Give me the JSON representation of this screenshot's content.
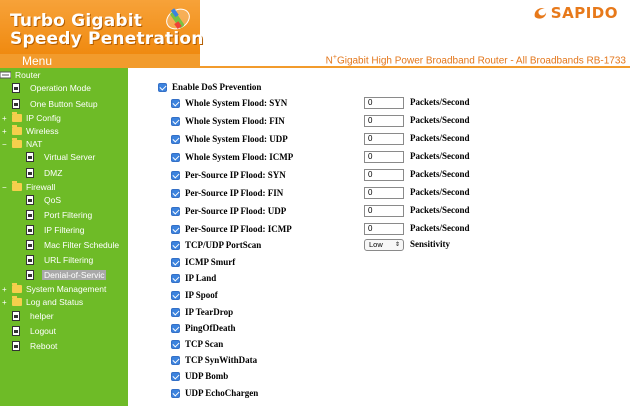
{
  "brand": {
    "line1": "Turbo Gigabit",
    "line2": "Speedy Penetration",
    "logo_text": "SAPIDO",
    "menu_label": "Menu",
    "tagline_prefix": "N",
    "tagline_sup": "+",
    "tagline": "Gigabit High Power Broadband Router - All Broadbands   RB-1733",
    "accent": "#f29b2c",
    "sidebar_color": "#6ebb27"
  },
  "sidebar": {
    "root": "Router",
    "items": [
      {
        "label": "Operation Mode"
      },
      {
        "label": "One Button Setup"
      },
      {
        "label": "IP Config"
      },
      {
        "label": "Wireless"
      },
      {
        "label": "NAT"
      },
      {
        "label": "Virtual Server"
      },
      {
        "label": "DMZ"
      },
      {
        "label": "Firewall"
      },
      {
        "label": "QoS"
      },
      {
        "label": "Port Filtering"
      },
      {
        "label": "IP Filtering"
      },
      {
        "label": "Mac Filter Schedule"
      },
      {
        "label": "URL Filtering"
      },
      {
        "label": "Denial-of-Servic"
      },
      {
        "label": "System Management"
      },
      {
        "label": "Log and Status"
      },
      {
        "label": "helper"
      },
      {
        "label": "Logout"
      },
      {
        "label": "Reboot"
      }
    ]
  },
  "dos": {
    "enable_label": "Enable DoS Prevention",
    "unit": "Packets/Second",
    "sensitivity_label": "Sensitivity",
    "sensitivity_value": "Low",
    "floods": [
      {
        "label": "Whole System Flood: SYN",
        "value": "0"
      },
      {
        "label": "Whole System Flood: FIN",
        "value": "0"
      },
      {
        "label": "Whole System Flood: UDP",
        "value": "0"
      },
      {
        "label": "Whole System Flood: ICMP",
        "value": "0"
      },
      {
        "label": "Per-Source IP Flood: SYN",
        "value": "0"
      },
      {
        "label": "Per-Source IP Flood: FIN",
        "value": "0"
      },
      {
        "label": "Per-Source IP Flood: UDP",
        "value": "0"
      },
      {
        "label": "Per-Source IP Flood: ICMP",
        "value": "0"
      }
    ],
    "portscan_label": "TCP/UDP PortScan",
    "options": [
      {
        "label": "ICMP Smurf"
      },
      {
        "label": "IP Land"
      },
      {
        "label": "IP Spoof"
      },
      {
        "label": "IP TearDrop"
      },
      {
        "label": "PingOfDeath"
      },
      {
        "label": "TCP Scan"
      },
      {
        "label": "TCP SynWithData"
      },
      {
        "label": "UDP Bomb"
      },
      {
        "label": "UDP EchoChargen"
      }
    ]
  }
}
